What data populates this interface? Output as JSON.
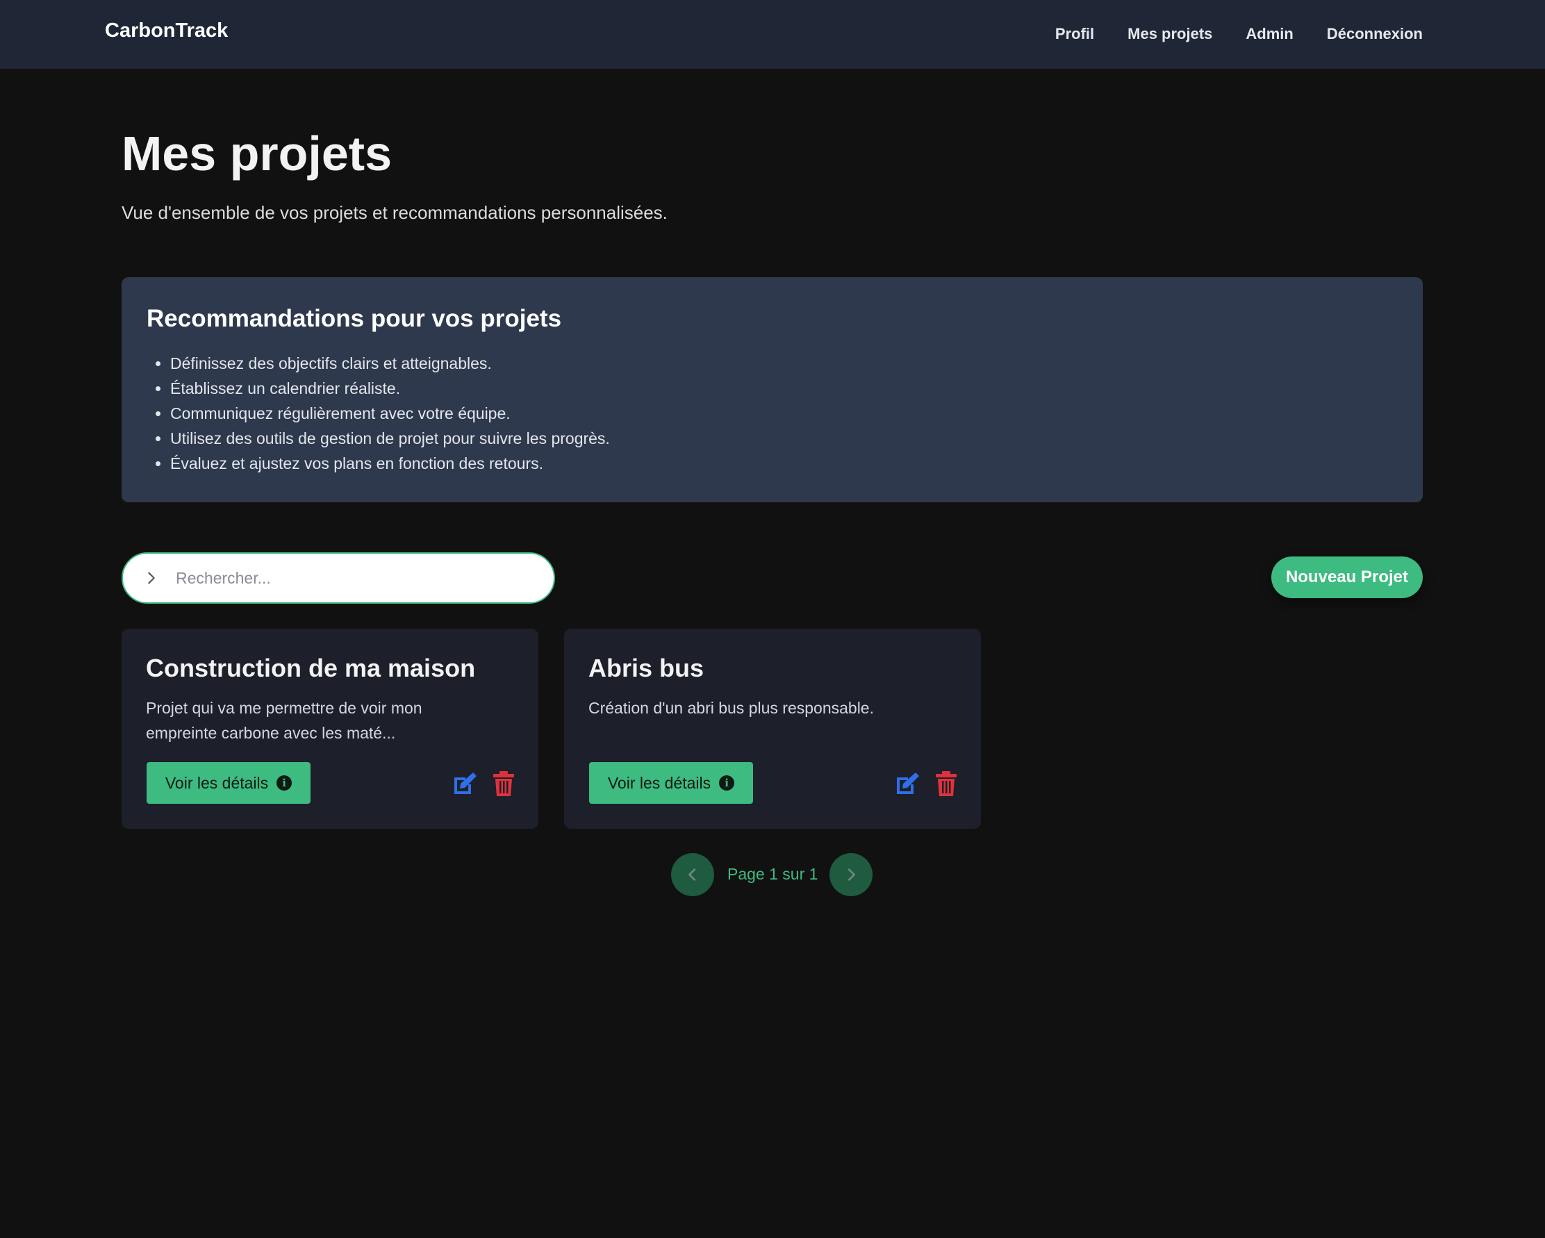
{
  "nav": {
    "brand": "CarbonTrack",
    "links": [
      "Profil",
      "Mes projets",
      "Admin",
      "Déconnexion"
    ]
  },
  "header": {
    "title": "Mes projets",
    "subtitle": "Vue d'ensemble de vos projets et recommandations personnalisées."
  },
  "recommendations": {
    "title": "Recommandations pour vos projets",
    "items": [
      "Définissez des objectifs clairs et atteignables.",
      "Établissez un calendrier réaliste.",
      "Communiquez régulièrement avec votre équipe.",
      "Utilisez des outils de gestion de projet pour suivre les progrès.",
      "Évaluez et ajustez vos plans en fonction des retours."
    ]
  },
  "search": {
    "placeholder": "Rechercher...",
    "value": ""
  },
  "new_project_label": "Nouveau Projet",
  "projects": [
    {
      "title": "Construction de ma maison",
      "description": "Projet qui va me permettre de voir mon empreinte carbone avec les maté...",
      "details_label": "Voir les détails"
    },
    {
      "title": "Abris bus",
      "description": "Création d'un abri bus plus responsable.",
      "details_label": "Voir les détails"
    }
  ],
  "pagination": {
    "text": "Page 1 sur 1"
  },
  "colors": {
    "accent": "#3dbb81",
    "edit": "#2f6fe8",
    "delete": "#e0323c",
    "navbar": "#1f2736",
    "panel": "#2f394d",
    "card": "#1d1f2b",
    "background": "#111111"
  },
  "icons": {
    "search": "chevron-right-icon",
    "details": "info-circle-icon",
    "edit": "edit-icon",
    "delete": "trash-icon",
    "prev": "chevron-left-icon",
    "next": "chevron-right-icon"
  }
}
